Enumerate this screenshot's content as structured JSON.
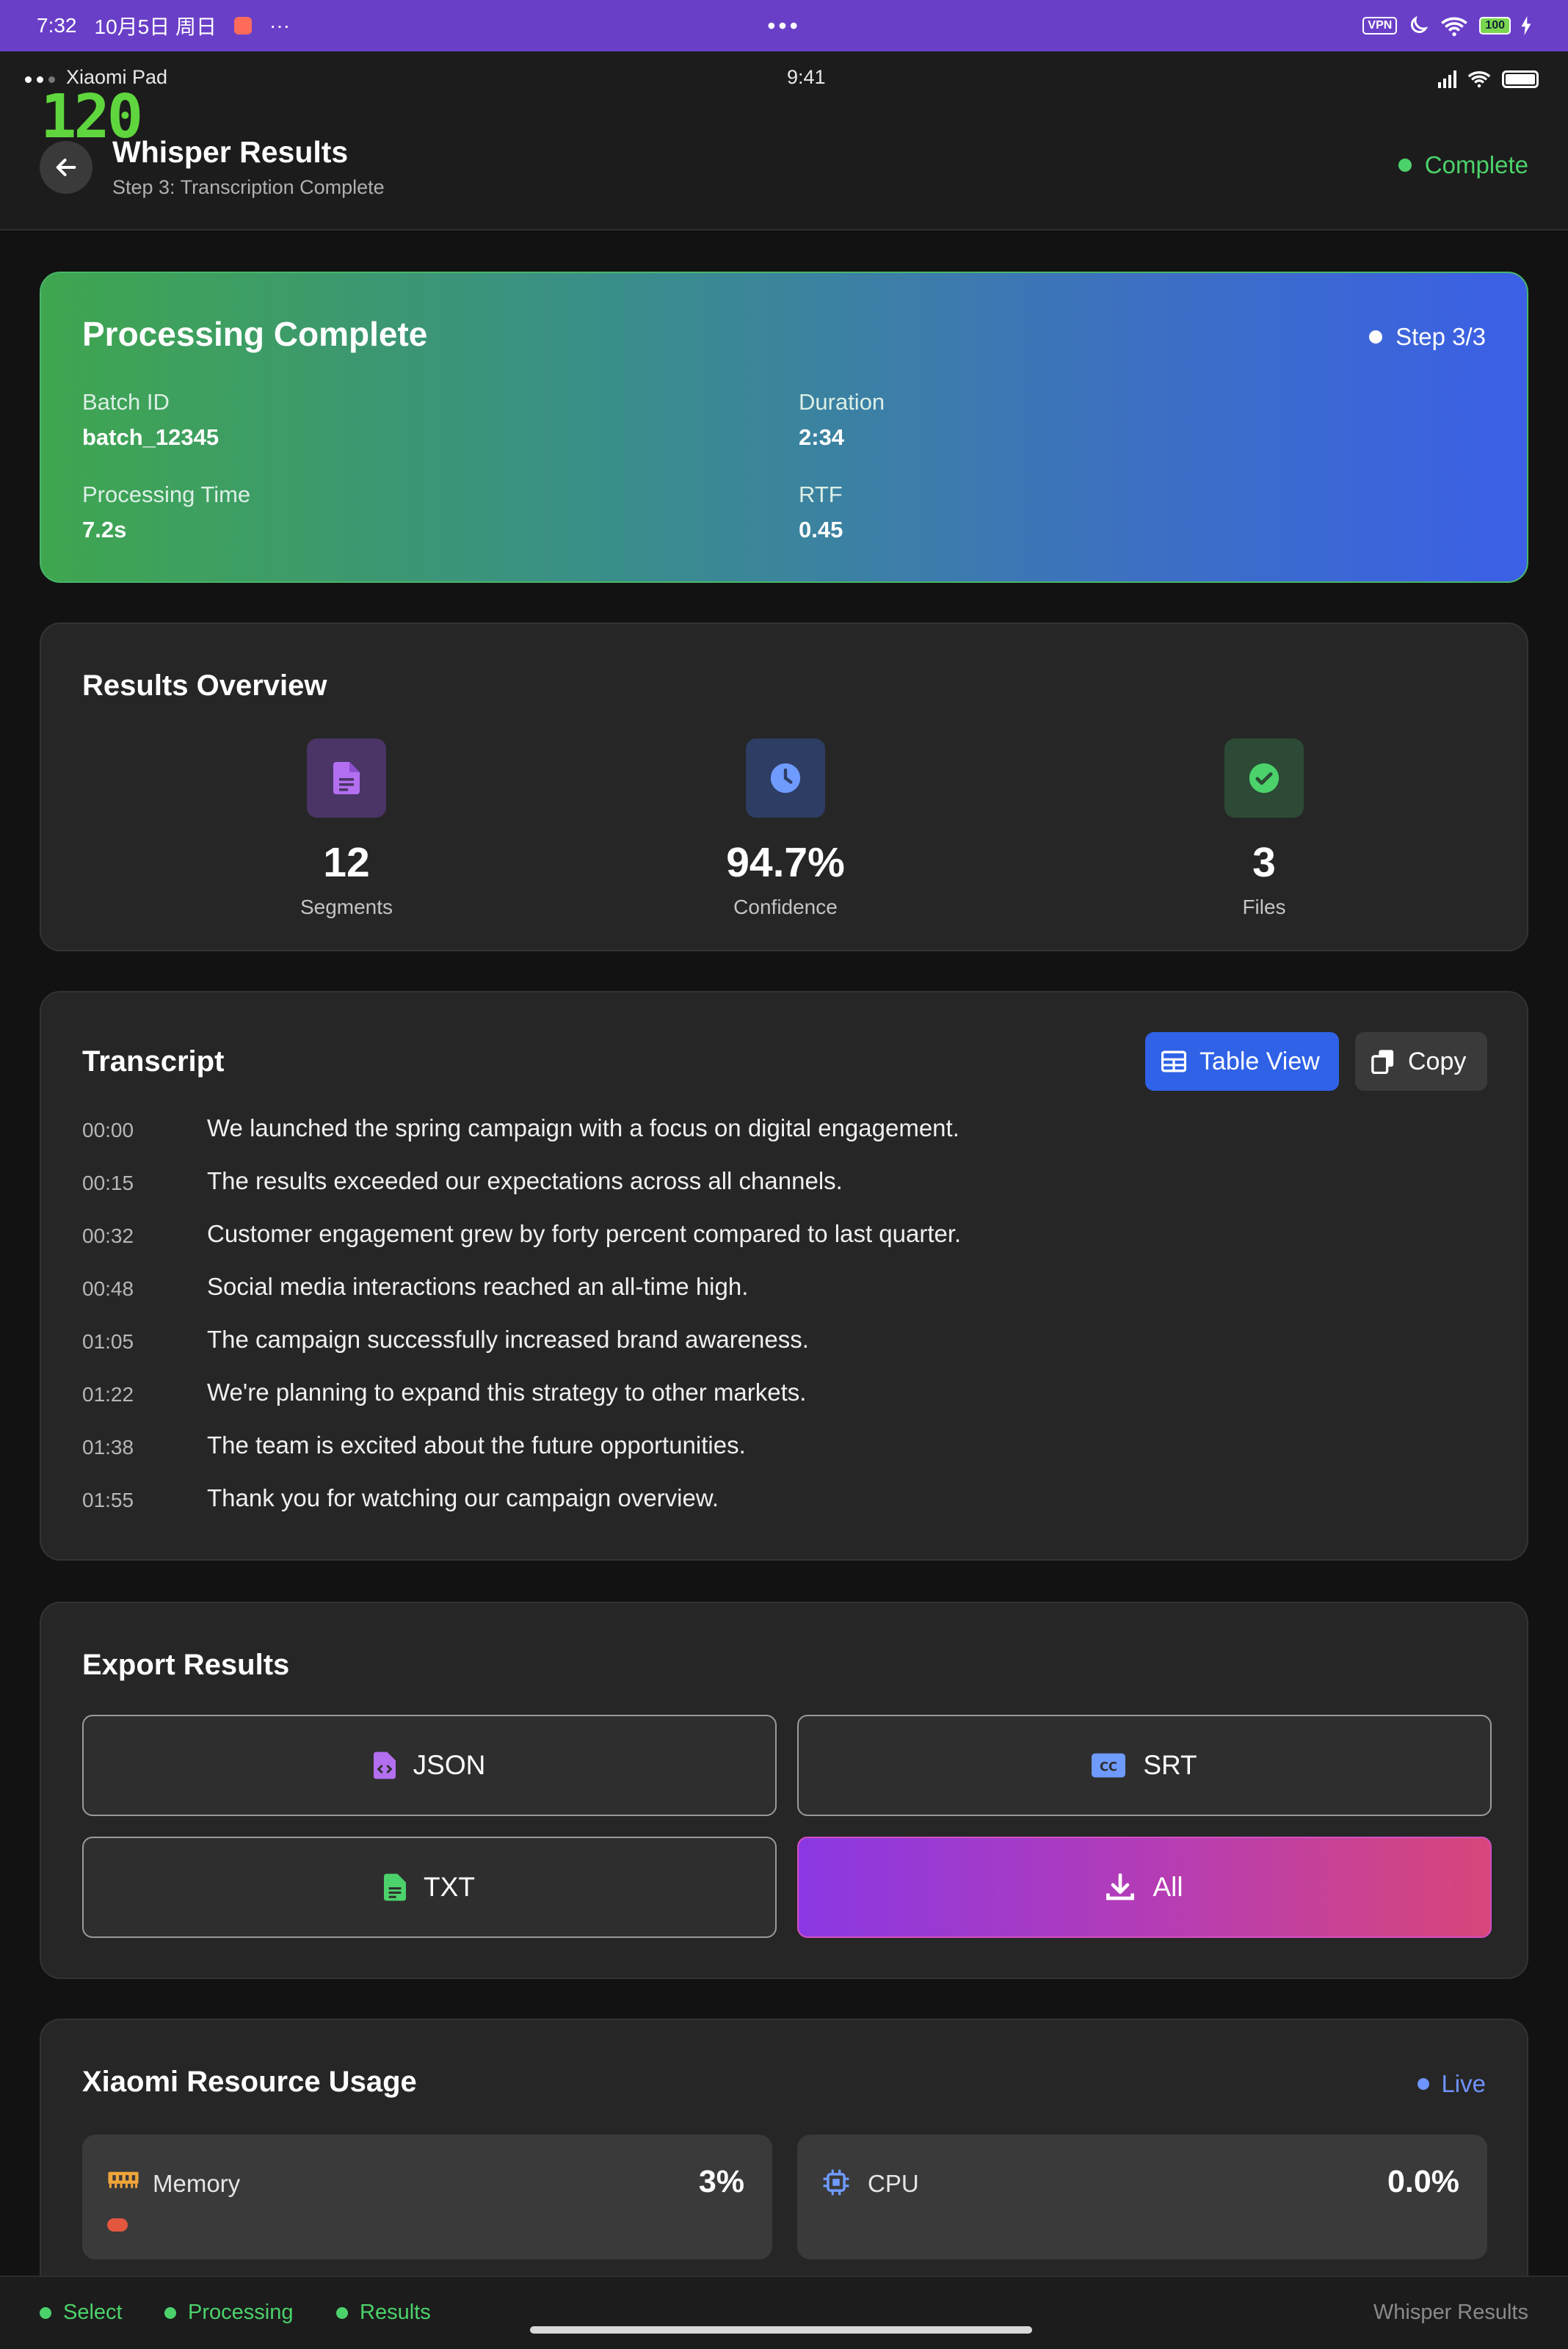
{
  "system_bar": {
    "time": "7:32",
    "date": "10月5日 周日",
    "more": "···",
    "center_dots": "•••",
    "vpn": "VPN",
    "battery": "100"
  },
  "device_bar": {
    "device": "Xiaomi Pad",
    "clock": "9:41"
  },
  "fps_overlay": "120",
  "header": {
    "title": "Whisper Results",
    "subtitle": "Step 3: Transcription Complete",
    "status": "Complete",
    "status_color": "#4cd26b"
  },
  "hero": {
    "title": "Processing Complete",
    "step": "Step 3/3",
    "fields": [
      {
        "label": "Batch ID",
        "value": "batch_12345"
      },
      {
        "label": "Duration",
        "value": "2:34"
      },
      {
        "label": "Processing Time",
        "value": "7.2s"
      },
      {
        "label": "RTF",
        "value": "0.45"
      }
    ]
  },
  "overview": {
    "title": "Results Overview",
    "stats": [
      {
        "value": "12",
        "label": "Segments",
        "icon": "document-icon"
      },
      {
        "value": "94.7%",
        "label": "Confidence",
        "icon": "clock-icon"
      },
      {
        "value": "3",
        "label": "Files",
        "icon": "check-circle-icon"
      }
    ]
  },
  "transcript": {
    "title": "Transcript",
    "table_view_label": "Table View",
    "copy_label": "Copy",
    "rows": [
      {
        "time": "00:00",
        "text": "We launched the spring campaign with a focus on digital engagement."
      },
      {
        "time": "00:15",
        "text": "The results exceeded our expectations across all channels."
      },
      {
        "time": "00:32",
        "text": "Customer engagement grew by forty percent compared to last quarter."
      },
      {
        "time": "00:48",
        "text": "Social media interactions reached an all-time high."
      },
      {
        "time": "01:05",
        "text": "The campaign successfully increased brand awareness."
      },
      {
        "time": "01:22",
        "text": "We're planning to expand this strategy to other markets."
      },
      {
        "time": "01:38",
        "text": "The team is excited about the future opportunities."
      },
      {
        "time": "01:55",
        "text": "Thank you for watching our campaign overview."
      }
    ]
  },
  "export": {
    "title": "Export Results",
    "json_label": "JSON",
    "srt_label": "SRT",
    "txt_label": "TXT",
    "all_label": "All",
    "srt_icon_text": "CC"
  },
  "resources": {
    "title": "Xiaomi Resource Usage",
    "live_label": "Live",
    "memory_label": "Memory",
    "memory_value": "3%",
    "memory_fraction": 0.03,
    "cpu_label": "CPU",
    "cpu_value": "0.0%"
  },
  "bottom_nav": {
    "select": "Select",
    "processing": "Processing",
    "results": "Results",
    "page_name": "Whisper Results"
  },
  "colors": {
    "accent_blue": "#2f62e6",
    "success_green": "#4cd26b",
    "live_blue": "#6f93ff",
    "memory_orange": "#e4573f"
  }
}
